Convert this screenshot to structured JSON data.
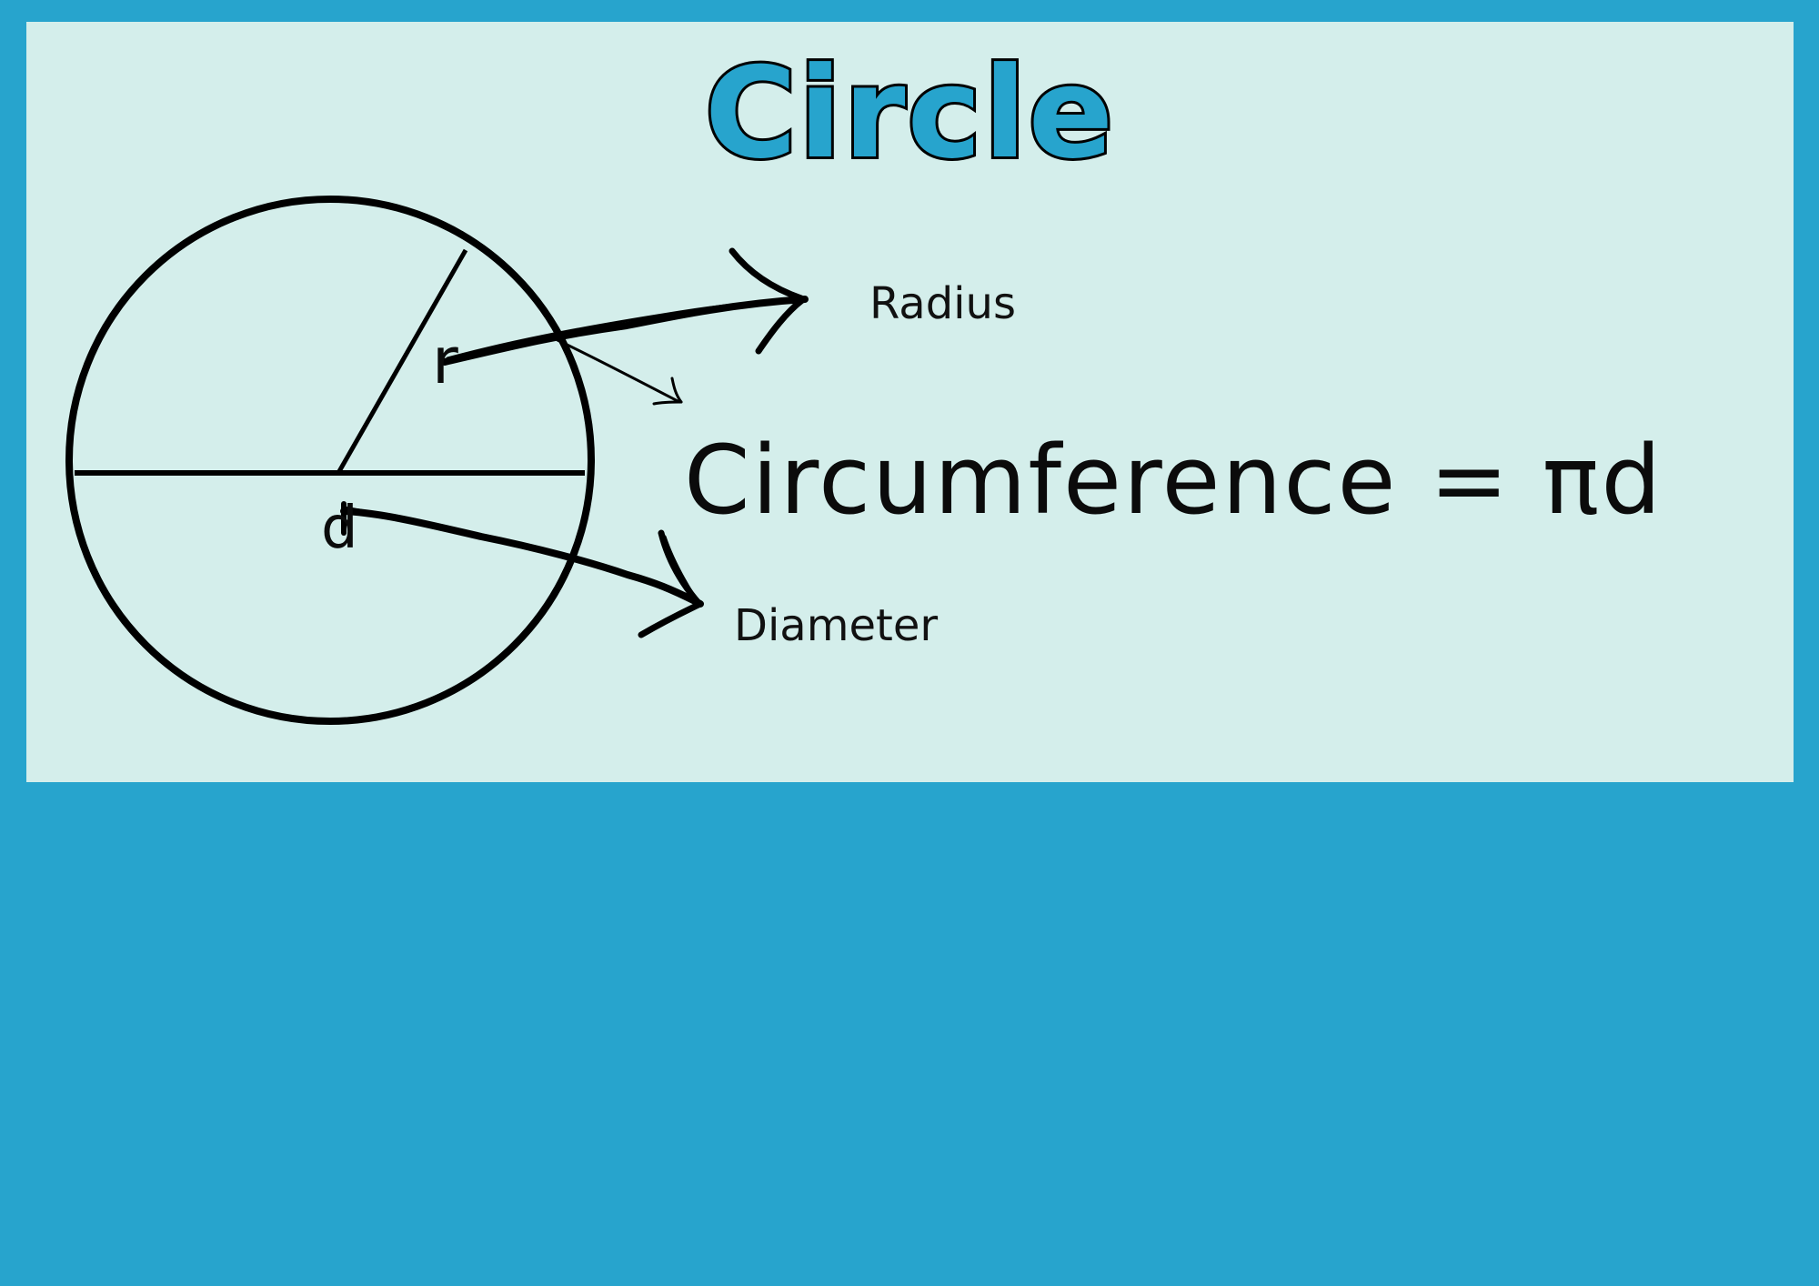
{
  "title": "Circle",
  "labels": {
    "radius": "Radius",
    "diameter": "Diameter"
  },
  "formula": "Circumference = πd",
  "variables": {
    "radius": "r",
    "diameter": "d"
  },
  "colors": {
    "background": "#27a4cd",
    "panel": "#d4eeeb",
    "title_fill": "#27a4cd",
    "ink": "#000000"
  }
}
